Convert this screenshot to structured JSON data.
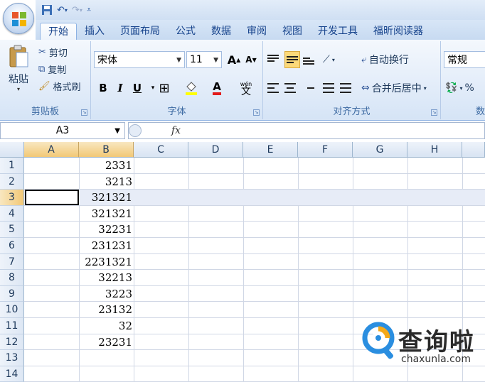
{
  "ribbon_tabs": [
    "开始",
    "插入",
    "页面布局",
    "公式",
    "数据",
    "审阅",
    "视图",
    "开发工具",
    "福昕阅读器"
  ],
  "active_tab": "开始",
  "clipboard": {
    "paste": "粘贴",
    "cut": "剪切",
    "copy": "复制",
    "format_painter": "格式刷",
    "label": "剪贴板"
  },
  "font": {
    "name": "宋体",
    "size": "11",
    "label": "字体",
    "bold": "B",
    "italic": "I",
    "underline": "U",
    "grow": "A",
    "shrink": "A",
    "color_letter": "A",
    "phonetic": "wén"
  },
  "alignment": {
    "wrap_text": "自动换行",
    "merge_center": "合并后居中",
    "label": "对齐方式"
  },
  "number": {
    "format": "常规",
    "label": "数",
    "percent": "%"
  },
  "formula_bar": {
    "name_box": "A3",
    "fx": "fx",
    "content": ""
  },
  "columns": [
    "A",
    "B",
    "C",
    "D",
    "E",
    "F",
    "G",
    "H"
  ],
  "rows": [
    "1",
    "2",
    "3",
    "4",
    "5",
    "6",
    "7",
    "8",
    "9",
    "10",
    "11",
    "12",
    "13",
    "14"
  ],
  "selected_row": "3",
  "cells_b": [
    "2331",
    "3213",
    "321321",
    "321321",
    "32231",
    "231231",
    "2231321",
    "32213",
    "3223",
    "23132",
    "32",
    "23231",
    "",
    ""
  ],
  "watermark": {
    "name": "查询啦",
    "url": "chaxunla.com"
  },
  "colors": {
    "accent": "#15428b",
    "header_highlight": "#f2c876",
    "ribbon_bg": "#e2ecf9"
  }
}
